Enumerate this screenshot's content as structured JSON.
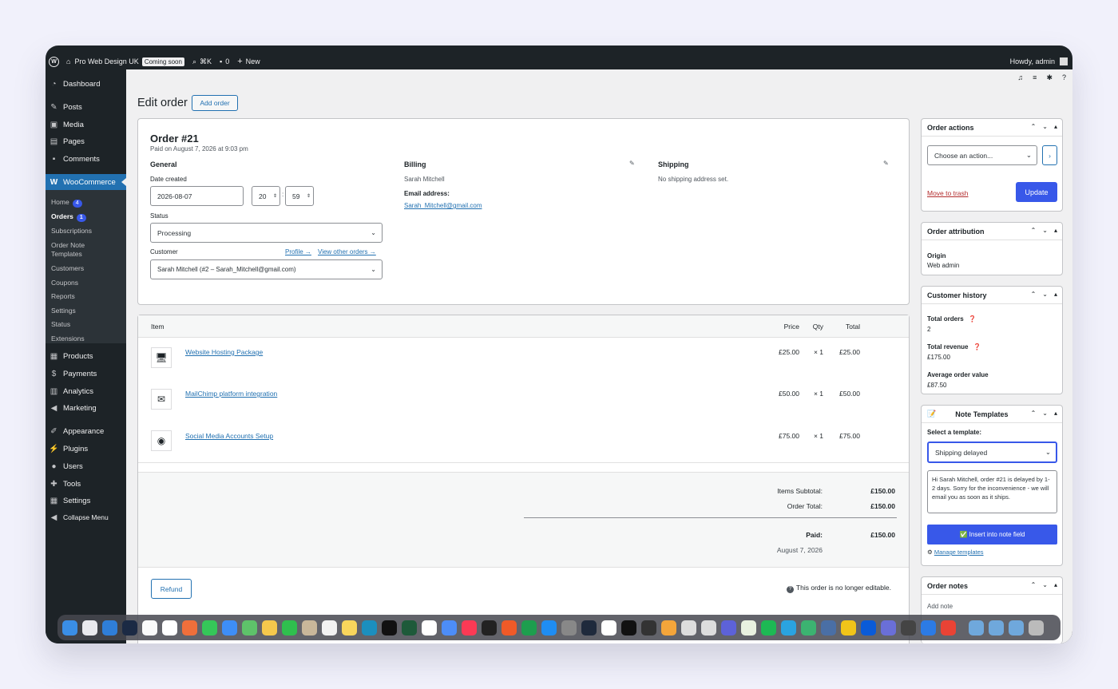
{
  "admin_bar": {
    "site_name": "Pro Web Design UK",
    "coming_soon": "Coming soon",
    "shortcut": "⌘K",
    "comments_count": "0",
    "new_label": "New",
    "howdy": "Howdy, admin"
  },
  "sidebar": {
    "items": [
      {
        "label": "Dashboard",
        "icon": "dashboard-icon"
      },
      {
        "label": "Posts",
        "icon": "pin-icon"
      },
      {
        "label": "Media",
        "icon": "media-icon"
      },
      {
        "label": "Pages",
        "icon": "page-icon"
      },
      {
        "label": "Comments",
        "icon": "comment-icon"
      },
      {
        "label": "WooCommerce",
        "icon": "woo-icon"
      },
      {
        "label": "Products",
        "icon": "box-icon"
      },
      {
        "label": "Payments",
        "icon": "dollar-icon"
      },
      {
        "label": "Analytics",
        "icon": "chart-icon"
      },
      {
        "label": "Marketing",
        "icon": "megaphone-icon"
      },
      {
        "label": "Appearance",
        "icon": "brush-icon"
      },
      {
        "label": "Plugins",
        "icon": "plug-icon"
      },
      {
        "label": "Users",
        "icon": "user-icon"
      },
      {
        "label": "Tools",
        "icon": "wrench-icon"
      },
      {
        "label": "Settings",
        "icon": "settings-icon"
      },
      {
        "label": "Collapse Menu",
        "icon": "collapse-icon"
      }
    ],
    "woo_sub": [
      {
        "label": "Home",
        "count": "4"
      },
      {
        "label": "Orders",
        "count": "1"
      },
      {
        "label": "Subscriptions"
      },
      {
        "label": "Order Note"
      },
      {
        "label": "Templates"
      },
      {
        "label": "Customers"
      },
      {
        "label": "Coupons"
      },
      {
        "label": "Reports"
      },
      {
        "label": "Settings"
      },
      {
        "label": "Status"
      },
      {
        "label": "Extensions"
      }
    ]
  },
  "page": {
    "title": "Edit order",
    "add_order": "Add order"
  },
  "order": {
    "title": "Order #21",
    "paid_on": "Paid on August 7, 2026 at 9:03 pm",
    "general": "General",
    "date_created_label": "Date created",
    "date": "2026-08-07",
    "hour": "20",
    "minute": "59",
    "status_label": "Status",
    "status": "Processing",
    "customer_label": "Customer",
    "profile_link": "Profile →",
    "other_orders_link": "View other orders →",
    "customer_value": "Sarah Mitchell (#2 – Sarah_Mitchell@gmail.com)",
    "billing": "Billing",
    "billing_name": "Sarah Mitchell",
    "email_label": "Email address:",
    "email": "Sarah_Mitchell@gmail.com",
    "shipping": "Shipping",
    "shipping_none": "No shipping address set."
  },
  "items": {
    "headers": {
      "item": "Item",
      "price": "Price",
      "qty": "Qty",
      "total": "Total"
    },
    "rows": [
      {
        "name": "Website Hosting Package",
        "price": "£25.00",
        "qty": "× 1",
        "total": "£25.00",
        "icon": "server-icon"
      },
      {
        "name": "MailChimp platform integration",
        "price": "£50.00",
        "qty": "× 1",
        "total": "£50.00",
        "icon": "mail-icon"
      },
      {
        "name": "Social Media Accounts Setup",
        "price": "£75.00",
        "qty": "× 1",
        "total": "£75.00",
        "icon": "social-icon"
      }
    ],
    "subtotal_label": "Items Subtotal:",
    "subtotal": "£150.00",
    "order_total_label": "Order Total:",
    "order_total": "£150.00",
    "paid_label": "Paid:",
    "paid": "£150.00",
    "paid_date": "August 7, 2026",
    "refund": "Refund",
    "not_editable": "This order is no longer editable."
  },
  "order_actions": {
    "title": "Order actions",
    "select": "Choose an action...",
    "trash": "Move to trash",
    "update": "Update"
  },
  "attribution": {
    "title": "Order attribution",
    "origin_label": "Origin",
    "origin": "Web admin"
  },
  "history": {
    "title": "Customer history",
    "total_orders_label": "Total orders",
    "total_orders": "2",
    "total_revenue_label": "Total revenue",
    "total_revenue": "£175.00",
    "aov_label": "Average order value",
    "aov": "£87.50"
  },
  "note_templates": {
    "title": "Note Templates",
    "select_label": "Select a template:",
    "selected": "Shipping delayed",
    "text": "Hi Sarah Mitchell, order #21 is delayed by 1-2 days. Sorry for the inconvenience - we will email you as soon as it ships.",
    "insert": "✅ Insert into note field",
    "manage": "Manage templates"
  },
  "order_notes": {
    "title": "Order notes",
    "add_note": "Add note"
  },
  "colors": {
    "primary": "#3858e9",
    "link": "#2271b1",
    "admin_bg": "#1d2327",
    "trash": "#b32d2e"
  }
}
